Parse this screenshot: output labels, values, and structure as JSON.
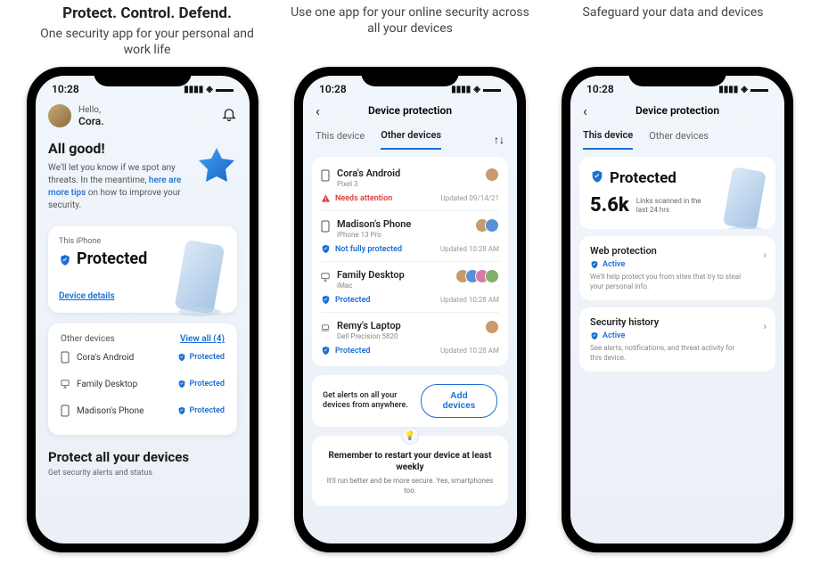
{
  "columns": [
    {
      "title": "Protect. Control. Defend.",
      "subtitle": "One security app for your personal and work life"
    },
    {
      "title": "",
      "subtitle": "Use one app for your online security across all your devices"
    },
    {
      "title": "",
      "subtitle": "Safeguard your data and devices"
    }
  ],
  "statusbar": {
    "time": "10:28"
  },
  "colors": {
    "accent": "#1a6fd6",
    "danger": "#d9403c"
  },
  "screen1": {
    "greeting_label": "Hello,",
    "greeting_name": "Cora.",
    "allgood_title": "All good!",
    "allgood_body_pre": "We'll let you know if we spot any threats. In the meantime, ",
    "allgood_link": "here are more tips",
    "allgood_body_post": " on how to improve your security.",
    "card_label": "This iPhone",
    "card_status": "Protected",
    "device_details": "Device details",
    "other_label": "Other devices",
    "view_all": "View all (4)",
    "devices": [
      {
        "icon": "phone",
        "name": "Cora's Android",
        "status": "Protected"
      },
      {
        "icon": "desktop",
        "name": "Family Desktop",
        "status": "Protected"
      },
      {
        "icon": "phone",
        "name": "Madison's Phone",
        "status": "Protected"
      }
    ],
    "protect_title": "Protect all your devices",
    "protect_sub": "Get security alerts and status"
  },
  "screen2": {
    "page_title": "Device protection",
    "tab_this": "This device",
    "tab_other": "Other devices",
    "devices": [
      {
        "icon": "phone",
        "name": "Cora's Android",
        "model": "Pixel 3",
        "status_level": "warn",
        "status_icon": "warning",
        "status": "Needs attention",
        "updated": "Updated 09/14/21",
        "avatars": 1
      },
      {
        "icon": "phone",
        "name": "Madison's Phone",
        "model": "iPhone 13 Pro",
        "status_level": "ok",
        "status_icon": "shield",
        "status": "Not fully protected",
        "updated": "Updated 10:28 AM",
        "avatars": 2
      },
      {
        "icon": "desktop",
        "name": "Family Desktop",
        "model": "iMac",
        "status_level": "ok",
        "status_icon": "shield",
        "status": "Protected",
        "updated": "Updated 10:28 AM",
        "avatars": 4
      },
      {
        "icon": "laptop",
        "name": "Remy's Laptop",
        "model": "Dell Precision 5820",
        "status_level": "ok",
        "status_icon": "shield",
        "status": "Protected",
        "updated": "Updated 10:28 AM",
        "avatars": 1
      }
    ],
    "cta_text": "Get alerts on all your devices from anywhere.",
    "cta_button": "Add devices",
    "tip_title": "Remember to restart your device at least weekly",
    "tip_body": "It'll run better and be more secure. Yes, smartphones too."
  },
  "screen3": {
    "page_title": "Device protection",
    "tab_this": "This device",
    "tab_other": "Other devices",
    "hero_status": "Protected",
    "metric_value": "5.6k",
    "metric_label": "Links scanned in the last 24 hrs",
    "sections": [
      {
        "title": "Web protection",
        "status": "Active",
        "desc": "We'll help protect you from sites that try to steal your personal info."
      },
      {
        "title": "Security history",
        "status": "Active",
        "desc": "See alerts, notifications, and threat activity for this device."
      }
    ]
  }
}
